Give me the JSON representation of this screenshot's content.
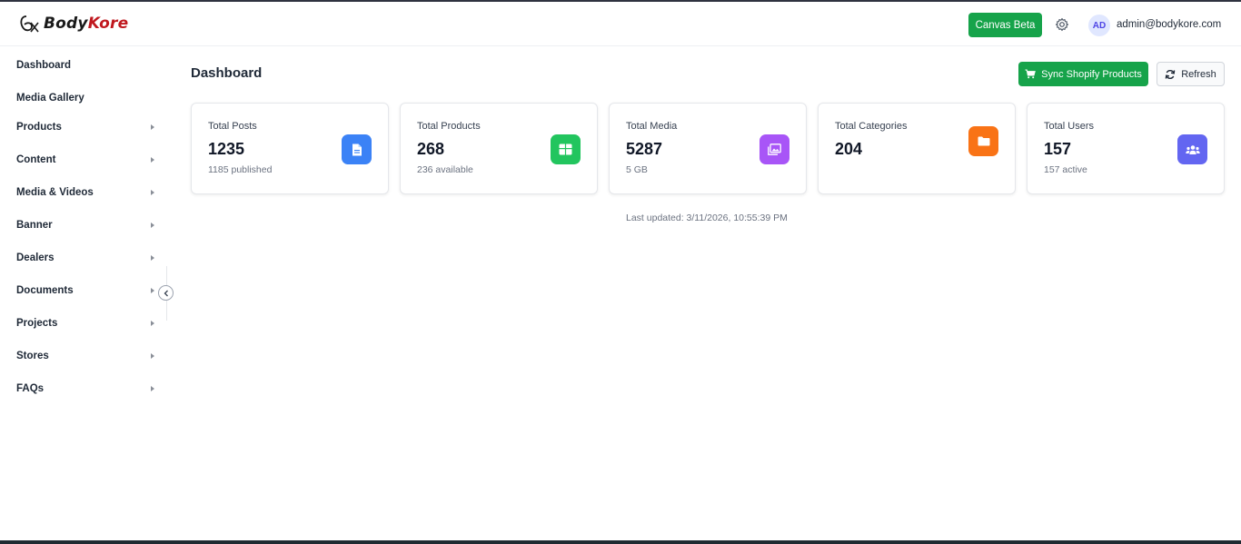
{
  "header": {
    "logo_body": "Body",
    "logo_kore": "Kore",
    "canvas_label": "Canvas Beta",
    "avatar_initials": "AD",
    "email": "admin@bodykore.com"
  },
  "sidebar": {
    "items": [
      {
        "label": "Dashboard",
        "has_submenu": false
      },
      {
        "label": "Media Gallery",
        "has_submenu": false
      },
      {
        "label": "Products",
        "has_submenu": true
      },
      {
        "label": "Content",
        "has_submenu": true
      },
      {
        "label": "Media & Videos",
        "has_submenu": true
      },
      {
        "label": "Banner",
        "has_submenu": true
      },
      {
        "label": "Dealers",
        "has_submenu": true
      },
      {
        "label": "Documents",
        "has_submenu": true
      },
      {
        "label": "Projects",
        "has_submenu": true
      },
      {
        "label": "Stores",
        "has_submenu": true
      },
      {
        "label": "FAQs",
        "has_submenu": true
      }
    ]
  },
  "main": {
    "title": "Dashboard",
    "sync_label": "Sync Shopify Products",
    "refresh_label": "Refresh",
    "cards": [
      {
        "label": "Total Posts",
        "value": "1235",
        "sub": "1185 published",
        "icon": "document-icon",
        "color": "#3b82f6"
      },
      {
        "label": "Total Products",
        "value": "268",
        "sub": "236 available",
        "icon": "box-icon",
        "color": "#22c55e"
      },
      {
        "label": "Total Media",
        "value": "5287",
        "sub": "5 GB",
        "icon": "image-icon",
        "color": "#a855f7"
      },
      {
        "label": "Total Categories",
        "value": "204",
        "sub": "",
        "icon": "folder-icon",
        "color": "#f97316"
      },
      {
        "label": "Total Users",
        "value": "157",
        "sub": "157 active",
        "icon": "users-icon",
        "color": "#6366f1"
      }
    ],
    "last_updated": "Last updated: 3/11/2026, 10:55:39 PM"
  },
  "colors": {
    "accent_green": "#16a34a",
    "brand_red": "#c0191f"
  }
}
